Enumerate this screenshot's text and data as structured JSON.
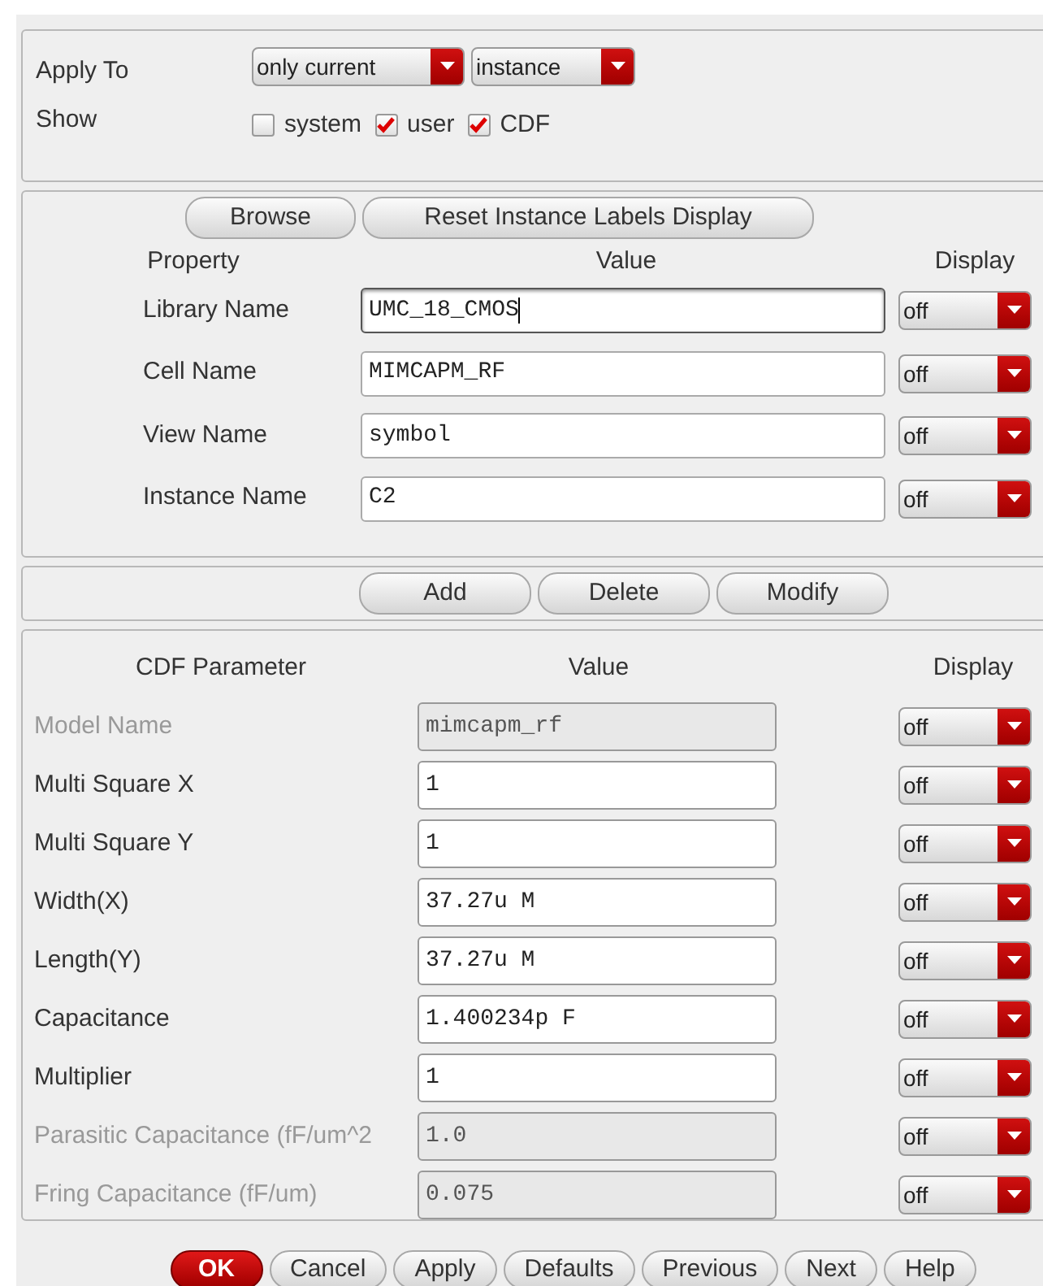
{
  "apply_to": {
    "label": "Apply To",
    "dropdowns": [
      {
        "value": "only current"
      },
      {
        "value": "instance"
      }
    ]
  },
  "show": {
    "label": "Show",
    "options": [
      {
        "label": "system",
        "checked": false
      },
      {
        "label": "user",
        "checked": true
      },
      {
        "label": "CDF",
        "checked": true
      }
    ]
  },
  "property_buttons": [
    "Browse",
    "Reset Instance Labels Display"
  ],
  "property_headers": [
    "Property",
    "Value",
    "Display"
  ],
  "properties": [
    {
      "name": "Library Name",
      "value": "UMC_18_CMOS",
      "focused": true,
      "display": "off"
    },
    {
      "name": "Cell Name",
      "value": "MIMCAPM_RF",
      "focused": false,
      "display": "off"
    },
    {
      "name": "View Name",
      "value": "symbol",
      "focused": false,
      "display": "off"
    },
    {
      "name": "Instance Name",
      "value": "C2",
      "focused": false,
      "display": "off"
    }
  ],
  "edit_buttons": [
    "Add",
    "Delete",
    "Modify"
  ],
  "cdf_headers": [
    "CDF Parameter",
    "Value",
    "Display"
  ],
  "cdf_parameters": [
    {
      "name": "Model Name",
      "value": "mimcapm_rf",
      "disabled": true,
      "display": "off"
    },
    {
      "name": "Multi Square X",
      "value": "1",
      "disabled": false,
      "display": "off"
    },
    {
      "name": "Multi Square Y",
      "value": "1",
      "disabled": false,
      "display": "off"
    },
    {
      "name": "Width(X)",
      "value": "37.27u M",
      "disabled": false,
      "display": "off"
    },
    {
      "name": "Length(Y)",
      "value": "37.27u M",
      "disabled": false,
      "display": "off"
    },
    {
      "name": "Capacitance",
      "value": "1.400234p F",
      "disabled": false,
      "display": "off"
    },
    {
      "name": "Multiplier",
      "value": "1",
      "disabled": false,
      "display": "off"
    },
    {
      "name": "Parasitic Capacitance (fF/um^2",
      "value": "1.0",
      "disabled": true,
      "display": "off"
    },
    {
      "name": "Fring Capacitance (fF/um)",
      "value": "0.075",
      "disabled": true,
      "display": "off"
    }
  ],
  "dialog_buttons": [
    {
      "label": "OK",
      "primary": true
    },
    {
      "label": "Cancel",
      "primary": false
    },
    {
      "label": "Apply",
      "primary": false
    },
    {
      "label": "Defaults",
      "primary": false
    },
    {
      "label": "Previous",
      "primary": false
    },
    {
      "label": "Next",
      "primary": false
    },
    {
      "label": "Help",
      "primary": false
    }
  ]
}
